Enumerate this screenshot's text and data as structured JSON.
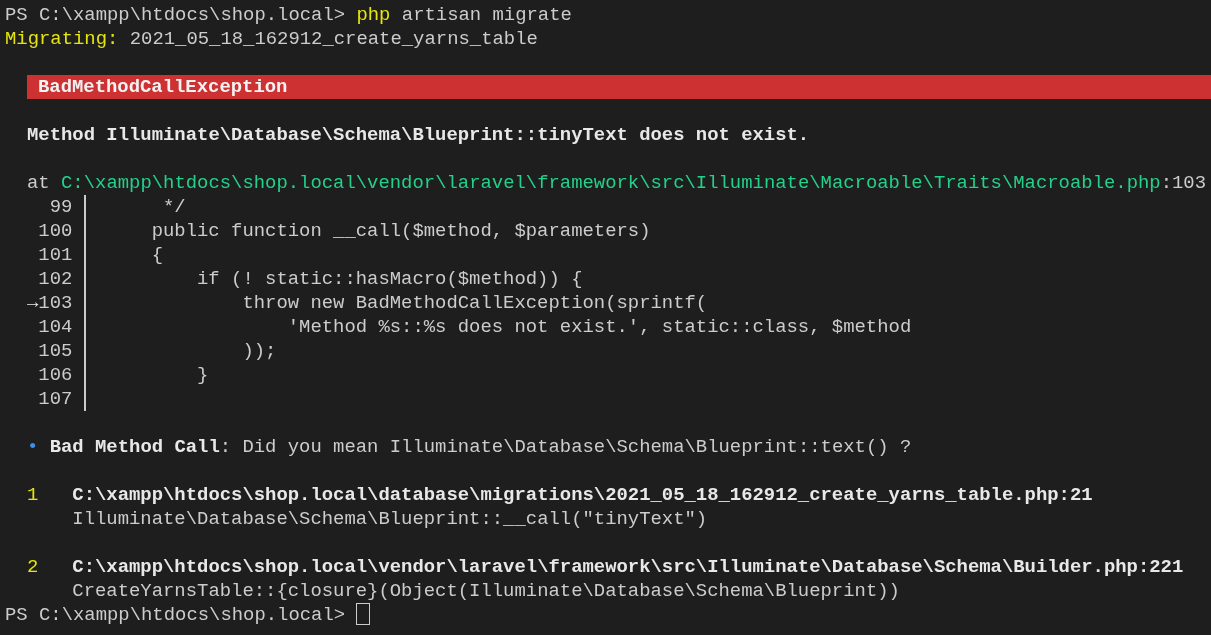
{
  "prompt": {
    "path": "PS C:\\xampp\\htdocs\\shop.local>",
    "command": "php",
    "arguments": "artisan migrate"
  },
  "migrating": {
    "label": "Migrating:",
    "name": "2021_05_18_162912_create_yarns_table"
  },
  "exception": {
    "title": "BadMethodCallException",
    "message": "Method Illuminate\\Database\\Schema\\Blueprint::tinyText does not exist."
  },
  "location": {
    "prefix": "at",
    "path": "C:\\xampp\\htdocs\\shop.local\\vendor\\laravel\\framework\\src\\Illuminate\\Macroable\\Traits\\Macroable.php",
    "line": ":103"
  },
  "code_excerpt": {
    "marker": "→",
    "lines": [
      {
        "number": "99",
        "code": "     */",
        "current": false
      },
      {
        "number": "100",
        "code": "    public function __call($method, $parameters)",
        "current": false
      },
      {
        "number": "101",
        "code": "    {",
        "current": false
      },
      {
        "number": "102",
        "code": "        if (! static::hasMacro($method)) {",
        "current": false
      },
      {
        "number": "103",
        "code": "            throw new BadMethodCallException(sprintf(",
        "current": true
      },
      {
        "number": "104",
        "code": "                'Method %s::%s does not exist.', static::class, $method",
        "current": false
      },
      {
        "number": "105",
        "code": "            ));",
        "current": false
      },
      {
        "number": "106",
        "code": "        }",
        "current": false
      },
      {
        "number": "107",
        "current": false
      }
    ]
  },
  "solution": {
    "bullet": "•",
    "title": "Bad Method Call",
    "text": ": Did you mean Illuminate\\Database\\Schema\\Blueprint::text() ?"
  },
  "frames": [
    {
      "index": "1",
      "path": "C:\\xampp\\htdocs\\shop.local\\database\\migrations\\2021_05_18_162912_create_yarns_table.php",
      "line": ":21",
      "call": "Illuminate\\Database\\Schema\\Blueprint::__call(\"tinyText\")"
    },
    {
      "index": "2",
      "path": "C:\\xampp\\htdocs\\shop.local\\vendor\\laravel\\framework\\src\\Illuminate\\Database\\Schema\\Builder.php",
      "line": ":221",
      "call": "CreateYarnsTable::{closure}(Object(Illuminate\\Database\\Schema\\Blueprint))"
    }
  ],
  "final_prompt": {
    "path": "PS C:\\xampp\\htdocs\\shop.local>"
  }
}
